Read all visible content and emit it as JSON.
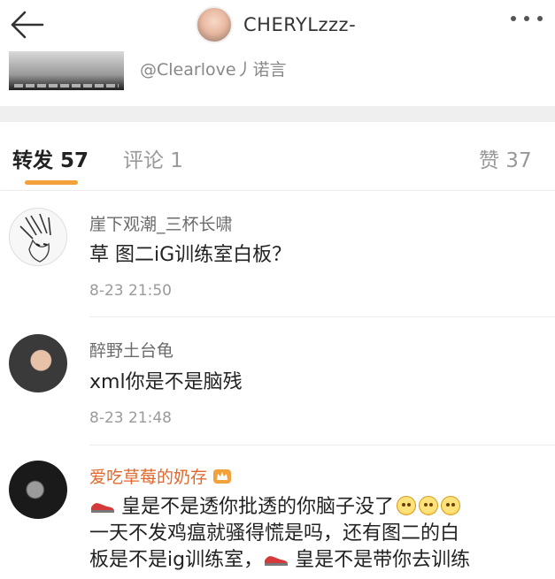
{
  "header": {
    "title": "CHERYLzzz-",
    "back_icon": "arrow-left-icon",
    "more_icon": "more-dots-icon"
  },
  "quoted": {
    "mention": "@Clearlove丿诺言"
  },
  "tabs": [
    {
      "label": "转发 57",
      "active": true
    },
    {
      "label": "评论 1",
      "active": false
    },
    {
      "label": "赞 37",
      "active": false
    }
  ],
  "colors": {
    "accent": "#f3a13a",
    "vip_name": "#e0682d",
    "divider": "#efefef"
  },
  "comments": [
    {
      "name": "崖下观潮_三杯长啸",
      "text": "草 图二iG训练室白板？",
      "time": "8-23 21:50"
    },
    {
      "name": "醉野土台龟",
      "text": "xml你是不是脑残",
      "time": "8-23 21:48"
    },
    {
      "name": "爱吃草莓的奶存",
      "badge_icon": "crown-vip-icon",
      "line1": "皇是不是透你批透的你脑子没了",
      "line2": "一天不发鸡瘟就骚得慌是吗，还有图二的白",
      "line3a": "板是不是ig训练室，",
      "line3b": "皇是不是带你去训练"
    }
  ]
}
